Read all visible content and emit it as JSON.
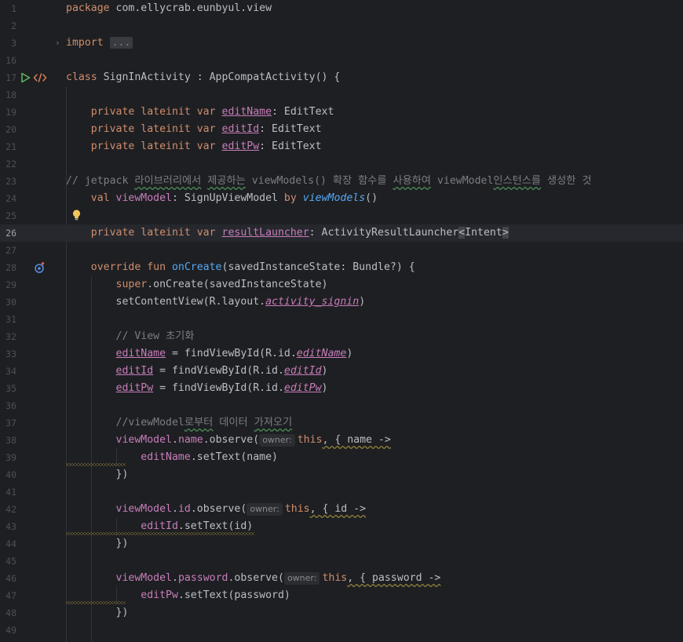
{
  "editor": {
    "current_line": "26",
    "lines": [
      {
        "n": "1"
      },
      {
        "n": "2"
      },
      {
        "n": "3"
      },
      {
        "n": "16"
      },
      {
        "n": "17"
      },
      {
        "n": "18"
      },
      {
        "n": "19"
      },
      {
        "n": "20"
      },
      {
        "n": "21"
      },
      {
        "n": "22"
      },
      {
        "n": "23"
      },
      {
        "n": "24"
      },
      {
        "n": "25"
      },
      {
        "n": "26"
      },
      {
        "n": "27"
      },
      {
        "n": "28"
      },
      {
        "n": "29"
      },
      {
        "n": "30"
      },
      {
        "n": "31"
      },
      {
        "n": "32"
      },
      {
        "n": "33"
      },
      {
        "n": "34"
      },
      {
        "n": "35"
      },
      {
        "n": "36"
      },
      {
        "n": "37"
      },
      {
        "n": "38"
      },
      {
        "n": "39"
      },
      {
        "n": "40"
      },
      {
        "n": "41"
      },
      {
        "n": "42"
      },
      {
        "n": "43"
      },
      {
        "n": "44"
      },
      {
        "n": "45"
      },
      {
        "n": "46"
      },
      {
        "n": "47"
      },
      {
        "n": "48"
      },
      {
        "n": "49"
      }
    ]
  },
  "code": {
    "l1": {
      "kw": "package",
      "rest": " com.ellycrab.eunbyul.view"
    },
    "l3": {
      "kw": "import",
      "fold": "..."
    },
    "l17": {
      "kw": "class",
      "rest": " SignInActivity : AppCompatActivity() {"
    },
    "l19": {
      "kw": "private lateinit var ",
      "name": "editName",
      "rest": ": EditText"
    },
    "l20": {
      "kw": "private lateinit var ",
      "name": "editId",
      "rest": ": EditText"
    },
    "l21": {
      "kw": "private lateinit var ",
      "name": "editPw",
      "rest": ": EditText"
    },
    "l23": {
      "a": "// jetpack ",
      "b": "라이브러리에서",
      "c": " ",
      "d": "제공하는",
      "e": " viewModels() 확장 함수를 ",
      "f": "사용하여",
      "g": " viewModel",
      "h": "인스턴스를",
      "i": " 생성한 것"
    },
    "l24": {
      "kw": "val ",
      "name": "viewModel",
      "mid": ": SignUpViewModel ",
      "by": "by ",
      "fn": "viewModels",
      "rest": "()"
    },
    "l26": {
      "kw": "private lateinit var ",
      "name": "resultLauncher",
      "mid": ": ActivityResultLauncher",
      "open": "<",
      "type": "Intent",
      "close": ">"
    },
    "l28": {
      "kw": "override fun ",
      "fn": "onCreate",
      "rest": "(savedInstanceState: Bundle?) {"
    },
    "l29": {
      "kw": "super",
      "rest": ".onCreate(savedInstanceState)"
    },
    "l30": {
      "pre": "setContentView(R.layout.",
      "field": "activity_signin",
      "rest": ")"
    },
    "l32": {
      "comment": "// View 초기화"
    },
    "l33": {
      "name": "editName",
      "mid": " = findViewById(R.id.",
      "field": "editName",
      "rest": ")"
    },
    "l34": {
      "name": "editId",
      "mid": " = findViewById(R.id.",
      "field": "editId",
      "rest": ")"
    },
    "l35": {
      "name": "editPw",
      "mid": " = findViewById(R.id.",
      "field": "editPw",
      "rest": ")"
    },
    "l37": {
      "a": "//viewModel",
      "b": "로부터",
      "c": " 데이터 ",
      "d": "가져오기"
    },
    "l38": {
      "vm": "viewModel",
      "dot": ".",
      "prop": "name",
      "rest": ".observe(",
      "hint": "owner:",
      "this": "this",
      "tail": ", { name ->"
    },
    "l39": {
      "name": "editName",
      "rest": ".setText(name)"
    },
    "l40": {
      "text": "})"
    },
    "l42": {
      "vm": "viewModel",
      "dot": ".",
      "prop": "id",
      "rest": ".observe(",
      "hint": "owner:",
      "this": "this",
      "tail": ", { id ->"
    },
    "l43": {
      "name": "editId",
      "rest": ".setText(id)"
    },
    "l44": {
      "text": "})"
    },
    "l46": {
      "vm": "viewModel",
      "dot": ".",
      "prop": "password",
      "rest": ".observe(",
      "hint": "owner:",
      "this": "this",
      "tail": ", { password ->"
    },
    "l47": {
      "name": "editPw",
      "rest": ".setText(password)"
    },
    "l48": {
      "text": "})"
    }
  },
  "icons": {
    "run": "run-gutter-icon",
    "code": "code-gutter-icon",
    "override": "override-gutter-icon",
    "bulb": "lightbulb-icon",
    "fold": "fold-arrow-icon"
  },
  "colors": {
    "background": "#1e1f22",
    "keyword": "#cf8e6d",
    "property": "#c77dbb",
    "function": "#56a8f5",
    "comment": "#7a7e85",
    "text": "#bcbec4"
  }
}
